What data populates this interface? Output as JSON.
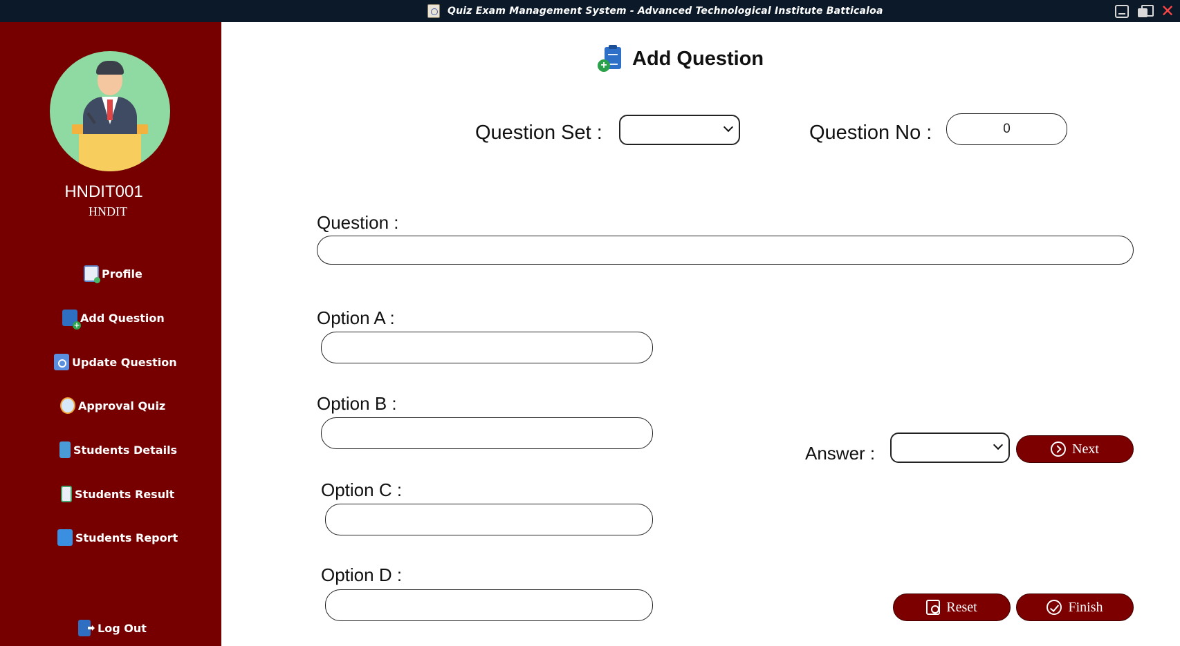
{
  "window": {
    "title": "Quiz Exam Management System - Advanced Technological Institute  Batticaloa",
    "close_glyph": "✕"
  },
  "user": {
    "id": "HNDIT001",
    "group": "HNDIT"
  },
  "sidebar": {
    "items": [
      {
        "label": "Profile",
        "icon": "profile-icon"
      },
      {
        "label": "Add Question",
        "icon": "add-question-icon"
      },
      {
        "label": "Update Question",
        "icon": "update-question-icon"
      },
      {
        "label": "Approval Quiz",
        "icon": "approval-quiz-icon"
      },
      {
        "label": "Students Details",
        "icon": "students-details-icon"
      },
      {
        "label": "Students Result",
        "icon": "students-result-icon"
      },
      {
        "label": "Students Report",
        "icon": "students-report-icon"
      }
    ],
    "logout_label": "Log Out"
  },
  "main": {
    "heading": "Add Question",
    "heading_plus": "+",
    "question_set": {
      "label": "Question Set :",
      "value": ""
    },
    "question_no": {
      "label": "Question No :",
      "value": "0"
    },
    "question": {
      "label": "Question :",
      "value": ""
    },
    "options": [
      {
        "label": "Option A :",
        "value": ""
      },
      {
        "label": "Option B :",
        "value": ""
      },
      {
        "label": "Option C :",
        "value": ""
      },
      {
        "label": "Option D :",
        "value": ""
      }
    ],
    "answer": {
      "label": "Answer :",
      "value": ""
    },
    "buttons": {
      "next": "Next",
      "reset": "Reset",
      "finish": "Finish"
    }
  },
  "colors": {
    "sidebar_bg": "#760000",
    "titlebar_bg": "#0b1929",
    "button_bg": "#7c0000",
    "avatar_bg": "#8fd9a2"
  }
}
